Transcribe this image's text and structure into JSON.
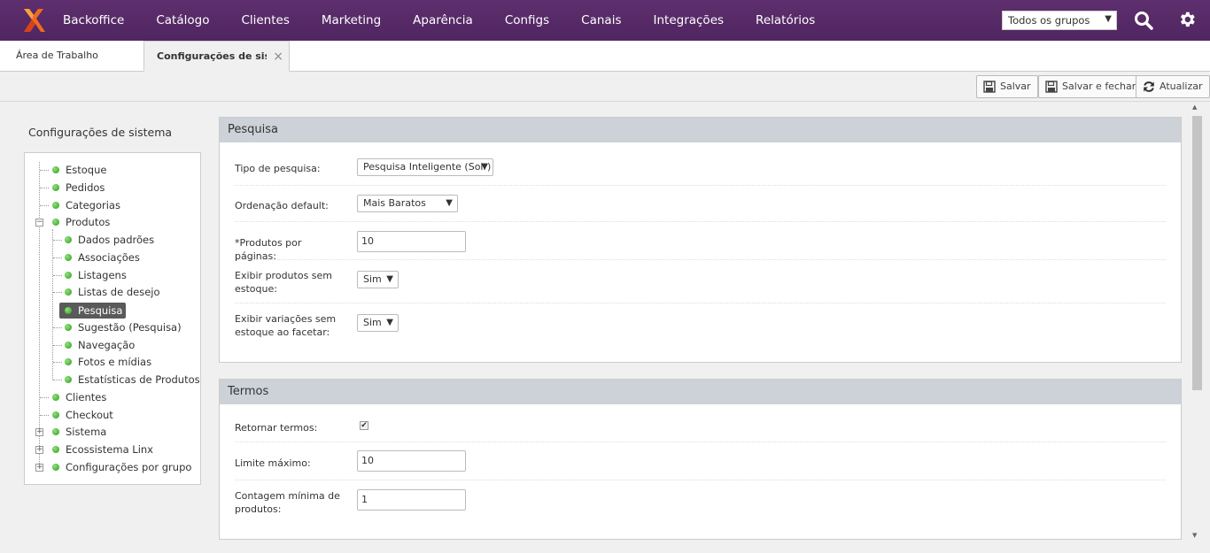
{
  "nav": {
    "items": [
      "Backoffice",
      "Catálogo",
      "Clientes",
      "Marketing",
      "Aparência",
      "Configs",
      "Canais",
      "Integrações",
      "Relatórios"
    ],
    "group_select": "Todos os grupos"
  },
  "tabs": {
    "home": "Área de Trabalho",
    "active": "Configurações de sistema",
    "close": "×"
  },
  "toolbar": {
    "save": "Salvar",
    "save_close": "Salvar e fechar",
    "refresh": "Atualizar"
  },
  "sidebar": {
    "title": "Configurações de sistema",
    "tree": [
      "Estoque",
      "Pedidos",
      "Categorias",
      "Produtos",
      "Dados padrões",
      "Associações",
      "Listagens",
      "Listas de desejo",
      "Pesquisa",
      "Sugestão (Pesquisa)",
      "Navegação",
      "Fotos e mídias",
      "Estatísticas de Produtos",
      "Clientes",
      "Checkout",
      "Sistema",
      "Ecossistema Linx",
      "Configurações por grupo"
    ]
  },
  "pesquisa": {
    "title": "Pesquisa",
    "tipo_label": "Tipo de pesquisa:",
    "tipo_value": "Pesquisa Inteligente (Solr)",
    "ordem_label": "Ordenação default:",
    "ordem_value": "Mais Baratos",
    "por_pagina_label": "*Produtos por páginas:",
    "por_pagina_value": "10",
    "sem_estoque_label": "Exibir produtos sem estoque:",
    "sem_estoque_value": "Sim",
    "variacoes_label": "Exibir variações sem estoque ao facetar:",
    "variacoes_value": "Sim"
  },
  "termos": {
    "title": "Termos",
    "retornar_label": "Retornar termos:",
    "retornar_checked": "✔",
    "limite_label": "Limite máximo:",
    "limite_value": "10",
    "contagem_label": "Contagem mínima de produtos:",
    "contagem_value": "1"
  },
  "icons": {
    "logo": "linx-logo-icon",
    "search": "search-icon",
    "gear": "gear-icon",
    "save": "floppy-icon",
    "refresh": "refresh-icon"
  }
}
